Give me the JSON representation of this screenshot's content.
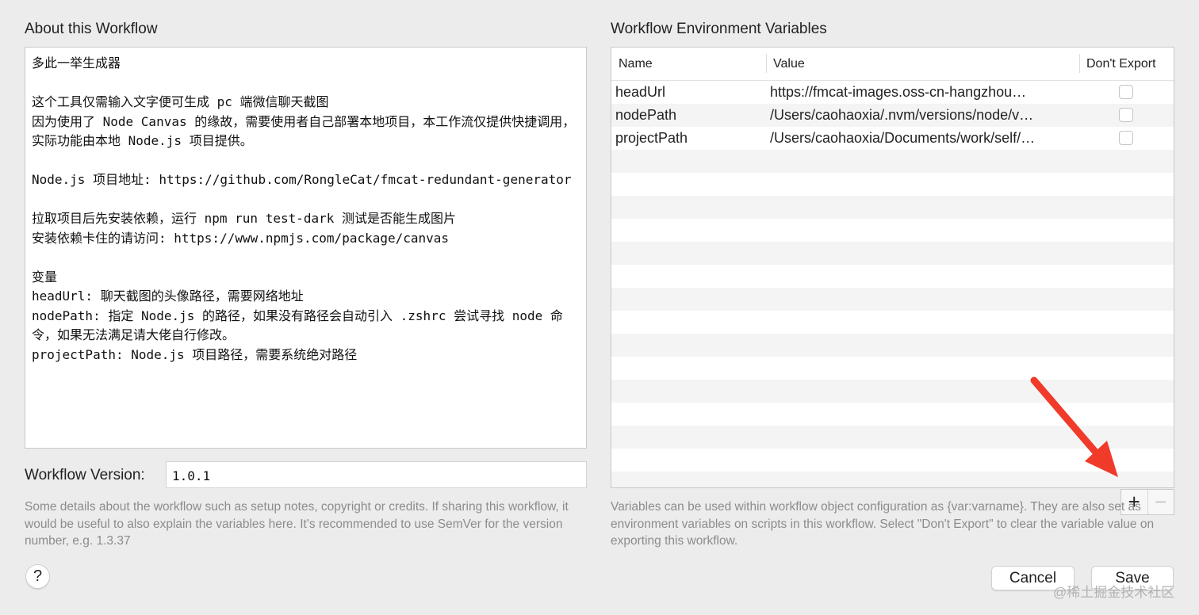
{
  "about": {
    "title": "About this Workflow",
    "text": "多此一举生成器\n\n这个工具仅需输入文字便可生成 pc 端微信聊天截图\n因为使用了 Node Canvas 的缘故，需要使用者自己部署本地项目，本工作流仅提供快捷调用，实际功能由本地 Node.js 项目提供。\n\nNode.js 项目地址: https://github.com/RongleCat/fmcat-redundant-generator\n\n拉取项目后先安装依赖，运行 npm run test-dark 测试是否能生成图片\n安装依赖卡住的请访问: https://www.npmjs.com/package/canvas\n\n变量\nheadUrl: 聊天截图的头像路径，需要网络地址\nnodePath: 指定 Node.js 的路径，如果没有路径会自动引入 .zshrc 尝试寻找 node 命令，如果无法满足请大佬自行修改。\nprojectPath: Node.js 项目路径，需要系统绝对路径",
    "version_label": "Workflow Version:",
    "version_value": "1.0.1",
    "help": "Some details about the workflow such as setup notes, copyright or credits. If sharing this workflow, it would be useful to also explain the variables here. It's recommended to use SemVer for the version number, e.g. 1.3.37"
  },
  "env": {
    "title": "Workflow Environment Variables",
    "columns": [
      "Name",
      "Value",
      "Don't Export"
    ],
    "rows": [
      {
        "name": "headUrl",
        "value": "https://fmcat-images.oss-cn-hangzhou…",
        "dont_export": false
      },
      {
        "name": "nodePath",
        "value": "/Users/caohaoxia/.nvm/versions/node/v…",
        "dont_export": false
      },
      {
        "name": "projectPath",
        "value": "/Users/caohaoxia/Documents/work/self/…",
        "dont_export": false
      }
    ],
    "help": "Variables can be used within workflow object configuration as {var:varname}. They are also set as environment variables on scripts in this workflow. Select \"Don't Export\" to clear the variable value on exporting this workflow.",
    "add_label": "+",
    "remove_label": "−"
  },
  "buttons": {
    "help": "?",
    "cancel": "Cancel",
    "save": "Save"
  },
  "watermark": "@稀土掘金技术社区",
  "annotation_color": "#f03a2a"
}
